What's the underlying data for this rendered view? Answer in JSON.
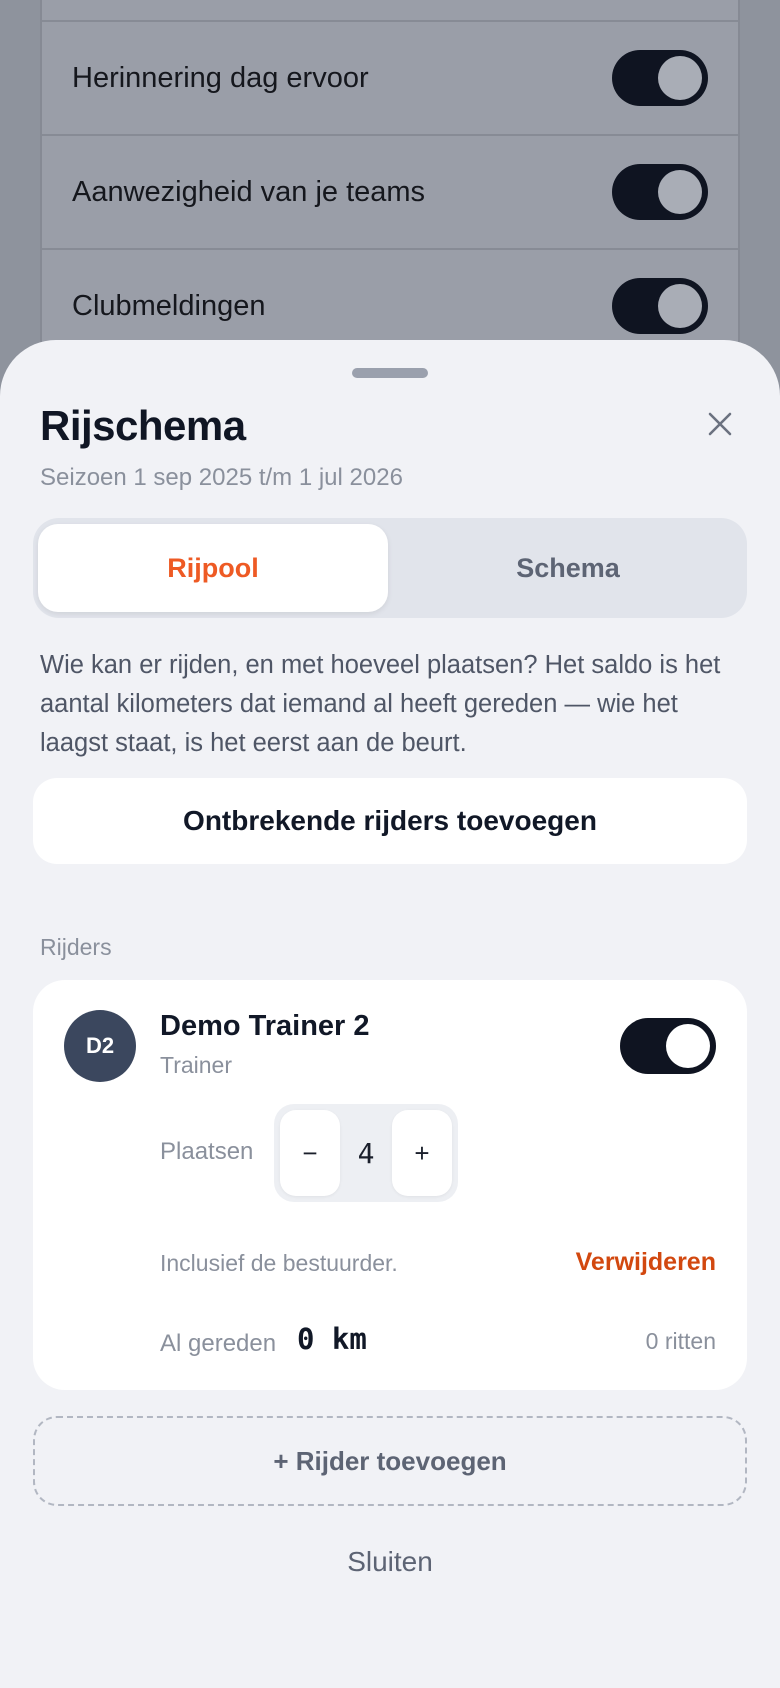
{
  "background": {
    "settings": [
      {
        "label": "Herinnering dag ervoor",
        "enabled": true
      },
      {
        "label": "Aanwezigheid van je teams",
        "enabled": true
      },
      {
        "label": "Clubmeldingen",
        "enabled": true
      }
    ]
  },
  "sheet": {
    "title": "Rijschema",
    "subtitle": "Seizoen 1 sep 2025 t/m 1 jul 2026",
    "tabs": [
      {
        "label": "Rijpool",
        "active": true
      },
      {
        "label": "Schema",
        "active": false
      }
    ],
    "description": "Wie kan er rijden, en met hoeveel plaatsen? Het saldo is het aantal kilometers dat iemand al heeft gereden — wie het laagst staat, is het eerst aan de beurt.",
    "add_missing_label": "Ontbrekende rijders toevoegen",
    "section_label": "Rijders",
    "riders": [
      {
        "initials": "D2",
        "name": "Demo Trainer 2",
        "role": "Trainer",
        "enabled": true,
        "places_label": "Plaatsen",
        "places": "4",
        "minus": "−",
        "plus": "+",
        "note": "Inclusief de bestuurder.",
        "remove_label": "Verwijderen",
        "driven_label": "Al gereden",
        "driven_value": "0 km",
        "rides": "0 ritten"
      }
    ],
    "add_rider_label": "+ Rijder toevoegen",
    "close_label": "Sluiten"
  },
  "colors": {
    "accent": "#ee5a24",
    "danger": "#d2480f",
    "dark": "#0f1421",
    "avatar": "#3b475e"
  }
}
